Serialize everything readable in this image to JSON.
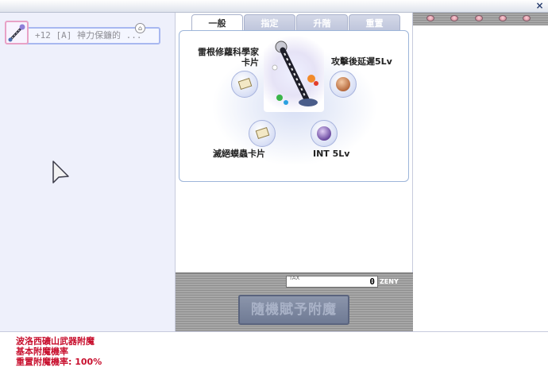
{
  "window": {
    "close_label": "×"
  },
  "item": {
    "name": "+12 [A] 神力保鐮的 ..."
  },
  "tabs": [
    {
      "label": "一般",
      "active": true
    },
    {
      "label": "指定",
      "active": false
    },
    {
      "label": "升階",
      "active": false
    },
    {
      "label": "重置",
      "active": false
    }
  ],
  "options": {
    "top_left": {
      "line1": "雷根修蘿科學家",
      "line2": "卡片",
      "icon": "card-icon"
    },
    "top_right": {
      "label": "攻擊後延遲5Lv",
      "icon": "copper-orb-icon"
    },
    "bottom_left": {
      "label": "滅絕蟆蟲卡片",
      "icon": "card-icon"
    },
    "bottom_right": {
      "label": "INT 5Lv",
      "icon": "purple-orb-icon"
    }
  },
  "tax": {
    "label": "TAX",
    "value": "0",
    "currency": "ZENY"
  },
  "random_button": {
    "label": "隨機賦予附魔"
  },
  "info": {
    "line1": "波洛西礦山武器附魔",
    "line2": "基本附魔機率",
    "line3": "重置附魔機率: 100%"
  },
  "colors": {
    "info_text": "#c8102e",
    "tab_border": "#a9b2cc",
    "panel_bg": "#eef0fb"
  }
}
